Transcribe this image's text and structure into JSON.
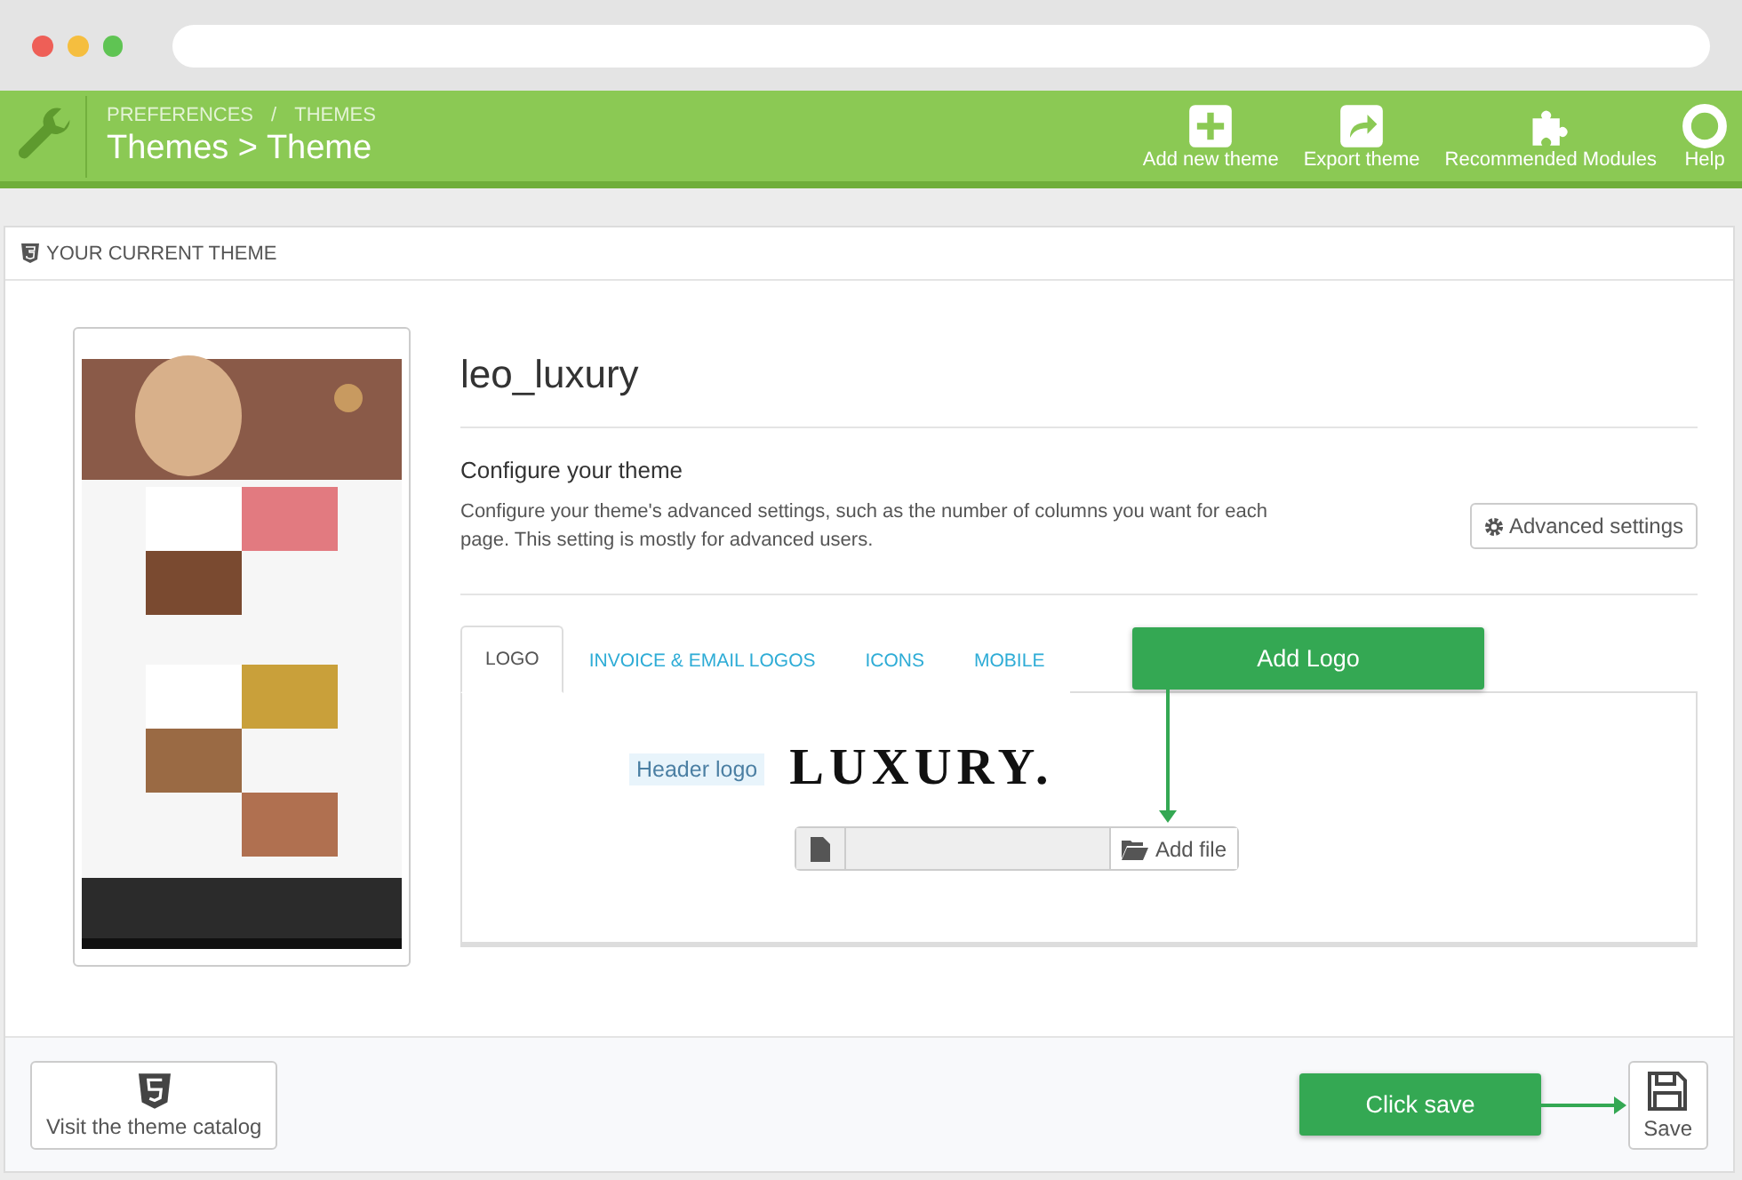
{
  "header": {
    "breadcrumbs": [
      "PREFERENCES",
      "THEMES"
    ],
    "separator": "/",
    "title": "Themes > Theme",
    "actions": [
      {
        "label": "Add new theme",
        "kind": "plus"
      },
      {
        "label": "Export theme",
        "kind": "share"
      },
      {
        "label": "Recommended Modules",
        "kind": "puzzle"
      },
      {
        "label": "Help",
        "kind": "lifebuoy"
      }
    ]
  },
  "panel": {
    "heading": "YOUR CURRENT THEME",
    "theme_name": "leo_luxury",
    "configure": {
      "title": "Configure your theme",
      "description": "Configure your theme's advanced settings, such as the number of columns you want for each page. This setting is mostly for advanced users.",
      "button": "Advanced settings"
    },
    "tabs": [
      {
        "label": "LOGO",
        "selected": true
      },
      {
        "label": "INVOICE & EMAIL LOGOS",
        "selected": false
      },
      {
        "label": "ICONS",
        "selected": false
      },
      {
        "label": "MOBILE",
        "selected": false
      }
    ],
    "logo_field": {
      "label": "Header logo",
      "logo": "LUXURY.",
      "button": "Add file"
    }
  },
  "footer": {
    "catalog_button": "Visit the theme catalog",
    "save_button": "Save"
  },
  "annotations": {
    "add_logo": "Add Logo",
    "click_save": "Click save"
  }
}
